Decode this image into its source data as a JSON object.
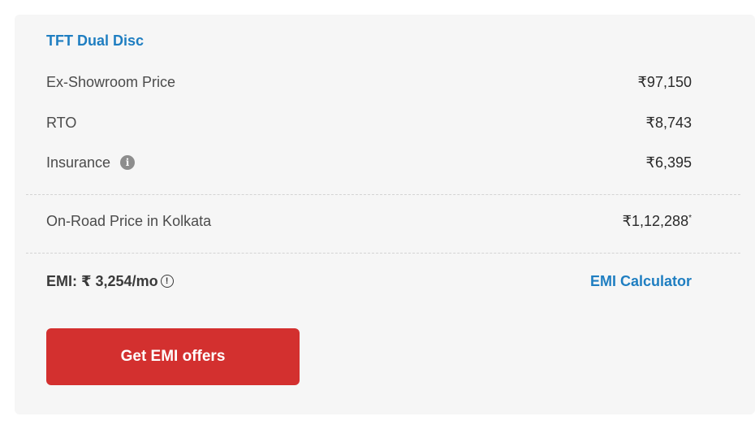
{
  "variant": {
    "name": "TFT Dual Disc"
  },
  "prices": {
    "ex_showroom": {
      "label": "Ex-Showroom Price",
      "value": "₹97,150"
    },
    "rto": {
      "label": "RTO",
      "value": "₹8,743"
    },
    "insurance": {
      "label": "Insurance",
      "value": "₹6,395",
      "info_icon": "info-icon"
    }
  },
  "on_road": {
    "label": "On-Road Price in Kolkata",
    "value": "₹1,12,288",
    "mark": "*"
  },
  "emi": {
    "text": "EMI: ₹ 3,254/mo",
    "info_icon": "exclamation-circle-icon",
    "calculator_label": "EMI Calculator"
  },
  "cta": {
    "label": "Get EMI offers"
  },
  "colors": {
    "link": "#1f7ec1",
    "cta_background": "#d3302f",
    "card_background": "#f6f6f6"
  }
}
